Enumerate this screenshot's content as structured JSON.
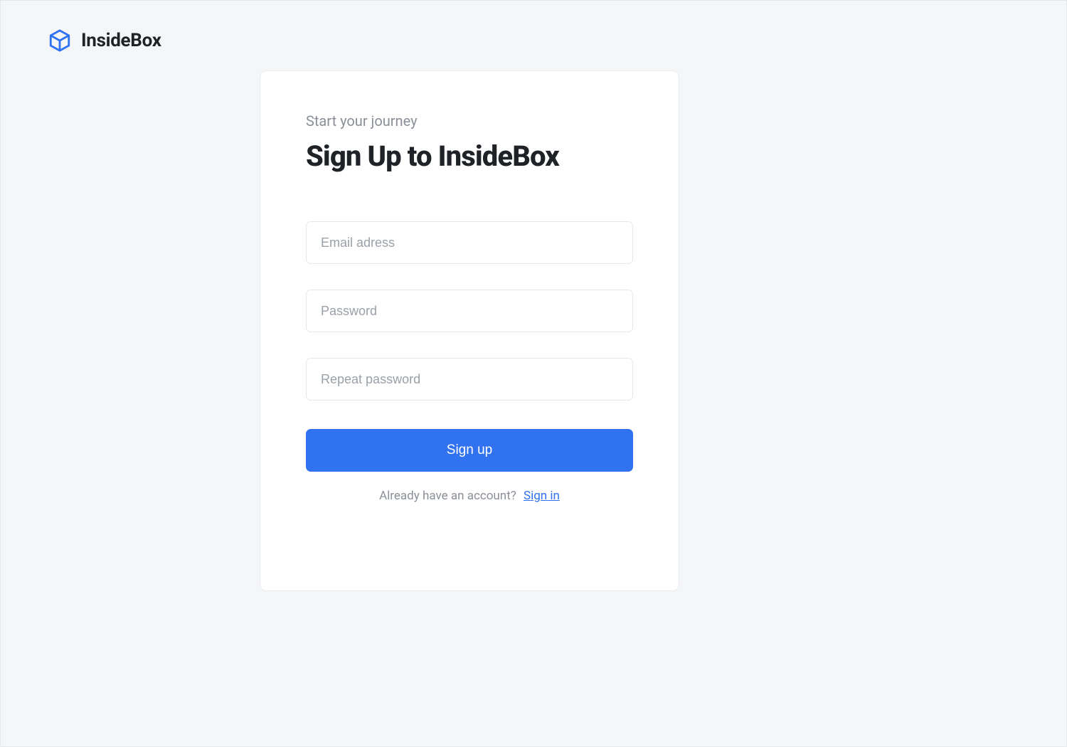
{
  "brand": {
    "name": "InsideBox"
  },
  "card": {
    "subtitle": "Start your journey",
    "title": "Sign Up to InsideBox",
    "fields": {
      "email_placeholder": "Email adress",
      "password_placeholder": "Password",
      "repeat_password_placeholder": "Repeat password"
    },
    "signup_button": "Sign up",
    "signin_prompt": "Already have an account?",
    "signin_link": "Sign in"
  },
  "colors": {
    "accent": "#3072f0",
    "text_dark": "#1f2328",
    "text_muted": "#8a8f98",
    "card_border": "#e9ecef",
    "page_bg": "#f5f6f8"
  }
}
